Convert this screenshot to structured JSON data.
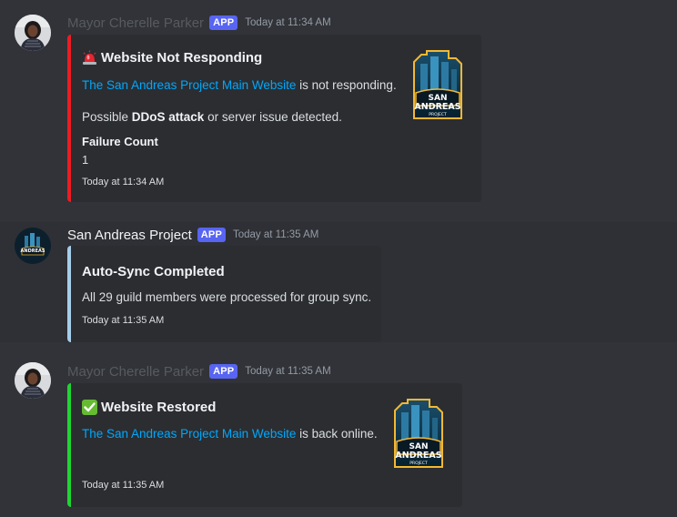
{
  "messages": [
    {
      "author": "Mayor Cherelle Parker",
      "badge": "APP",
      "timestamp": "Today at 11:34 AM",
      "embed": {
        "title": "Website Not Responding",
        "title_icon": "siren-icon",
        "link_text": "The San Andreas Project Main Website",
        "line1_suffix": " is not responding.",
        "line2_prefix": "Possible ",
        "line2_bold": "DDoS attack",
        "line2_suffix": " or server issue detected.",
        "field_name": "Failure Count",
        "field_value": "1",
        "footer": "Today at 11:34 AM",
        "accent": "#ed1c24"
      }
    },
    {
      "author": "San Andreas Project",
      "badge": "APP",
      "timestamp": "Today at 11:35 AM",
      "embed": {
        "title": "Auto-Sync Completed",
        "description": "All 29 guild members were processed for group sync.",
        "footer": "Today at 11:35 AM",
        "accent": "#a6ceeb"
      }
    },
    {
      "author": "Mayor Cherelle Parker",
      "badge": "APP",
      "timestamp": "Today at 11:35 AM",
      "embed": {
        "title": "Website Restored",
        "title_icon": "check-mark-icon",
        "link_text": "The San Andreas Project Main Website",
        "line1_suffix": " is back online.",
        "footer": "Today at 11:35 AM",
        "accent": "#1fd534"
      }
    }
  ],
  "logo": {
    "line1": "SAN",
    "line2": "ANDREAS",
    "line3": "PROJECT"
  }
}
